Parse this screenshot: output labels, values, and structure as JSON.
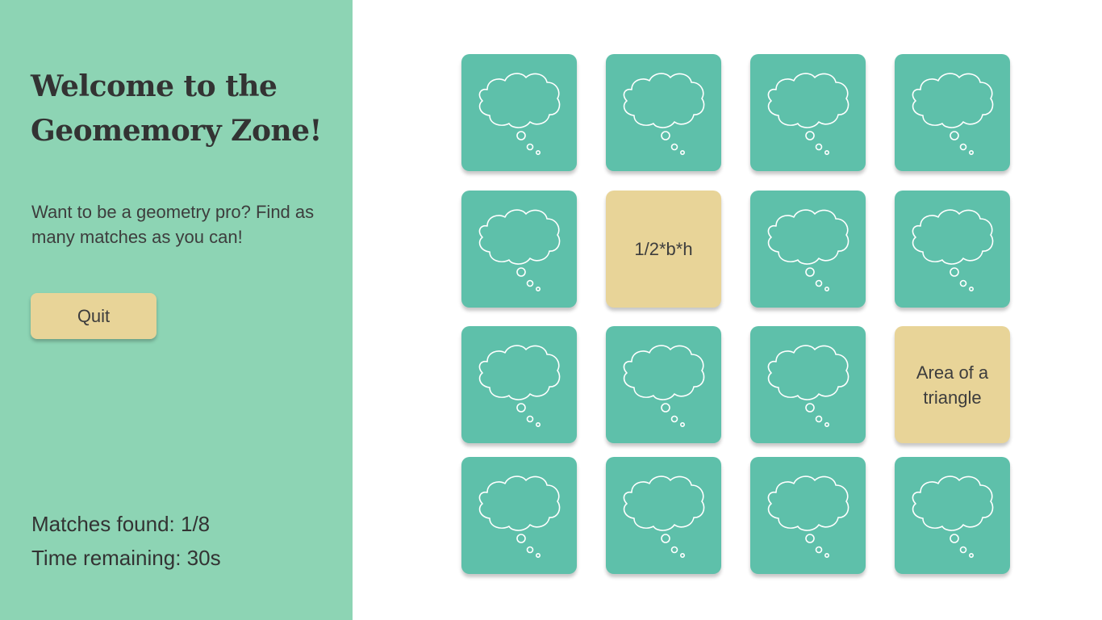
{
  "sidebar": {
    "title": "Welcome to the Geomemory Zone!",
    "intro": "Want to be a geometry pro? Find as many matches as you can!",
    "quit_label": "Quit",
    "matches_found": "Matches found: 1/8",
    "time_remaining": "Time remaining: 30s"
  },
  "colors": {
    "sidebar_bg": "#8dd4b4",
    "card_back": "#5ec0aa",
    "card_front": "#e8d498",
    "text": "#333333"
  },
  "board": {
    "cards": [
      {
        "state": "hidden",
        "icon": "thought-cloud-icon",
        "text": ""
      },
      {
        "state": "hidden",
        "icon": "thought-cloud-icon",
        "text": ""
      },
      {
        "state": "hidden",
        "icon": "thought-cloud-icon",
        "text": ""
      },
      {
        "state": "hidden",
        "icon": "thought-cloud-icon",
        "text": ""
      },
      {
        "state": "hidden",
        "icon": "thought-cloud-icon",
        "text": ""
      },
      {
        "state": "revealed",
        "icon": "",
        "text": "1/2*b*h"
      },
      {
        "state": "hidden",
        "icon": "thought-cloud-icon",
        "text": ""
      },
      {
        "state": "hidden",
        "icon": "thought-cloud-icon",
        "text": ""
      },
      {
        "state": "hidden",
        "icon": "thought-cloud-icon",
        "text": ""
      },
      {
        "state": "hidden",
        "icon": "thought-cloud-icon",
        "text": ""
      },
      {
        "state": "hidden",
        "icon": "thought-cloud-icon",
        "text": ""
      },
      {
        "state": "revealed",
        "icon": "",
        "text": "Area of a triangle"
      },
      {
        "state": "hidden",
        "icon": "thought-cloud-icon",
        "text": ""
      },
      {
        "state": "hidden",
        "icon": "thought-cloud-icon",
        "text": ""
      },
      {
        "state": "hidden",
        "icon": "thought-cloud-icon",
        "text": ""
      },
      {
        "state": "hidden",
        "icon": "thought-cloud-icon",
        "text": ""
      }
    ]
  }
}
